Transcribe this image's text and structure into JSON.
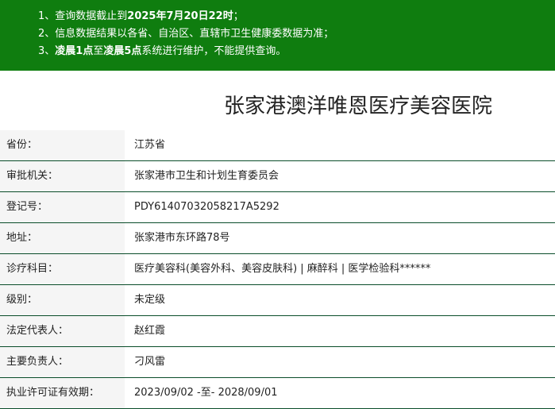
{
  "notice": {
    "line1": {
      "prefix": "1、查询数据截止到",
      "bold": "2025年7月20日22时",
      "suffix": "；"
    },
    "line2": {
      "text": "2、信息数据结果以各省、自治区、直辖市卫生健康委数据为准；"
    },
    "line3": {
      "prefix": "3、",
      "bold1": "凌晨1点",
      "mid": "至",
      "bold2": "凌晨5点",
      "suffix": "系统进行维护，不能提供查询。"
    }
  },
  "hospital": {
    "name": "张家港澳洋唯恩医疗美容医院"
  },
  "rows": [
    {
      "label": "省份：",
      "value": "江苏省"
    },
    {
      "label": "审批机关：",
      "value": "张家港市卫生和计划生育委员会"
    },
    {
      "label": "登记号：",
      "value": "PDY61407032058217A5292"
    },
    {
      "label": "地址：",
      "value": "张家港市东环路78号"
    },
    {
      "label": "诊疗科目：",
      "value": "医疗美容科(美容外科、美容皮肤科) | 麻醉科 | 医学检验科******"
    },
    {
      "label": "级别：",
      "value": "未定级"
    },
    {
      "label": "法定代表人：",
      "value": "赵红霞"
    },
    {
      "label": "主要负责人：",
      "value": "刁风雷"
    },
    {
      "label": "执业许可证有效期：",
      "value": "2023/09/02 -至- 2028/09/01"
    }
  ],
  "colors": {
    "notice_bg": "#0f7d0f",
    "row_border": "#0a4d2a",
    "label_bg": "#f5f5f5"
  }
}
